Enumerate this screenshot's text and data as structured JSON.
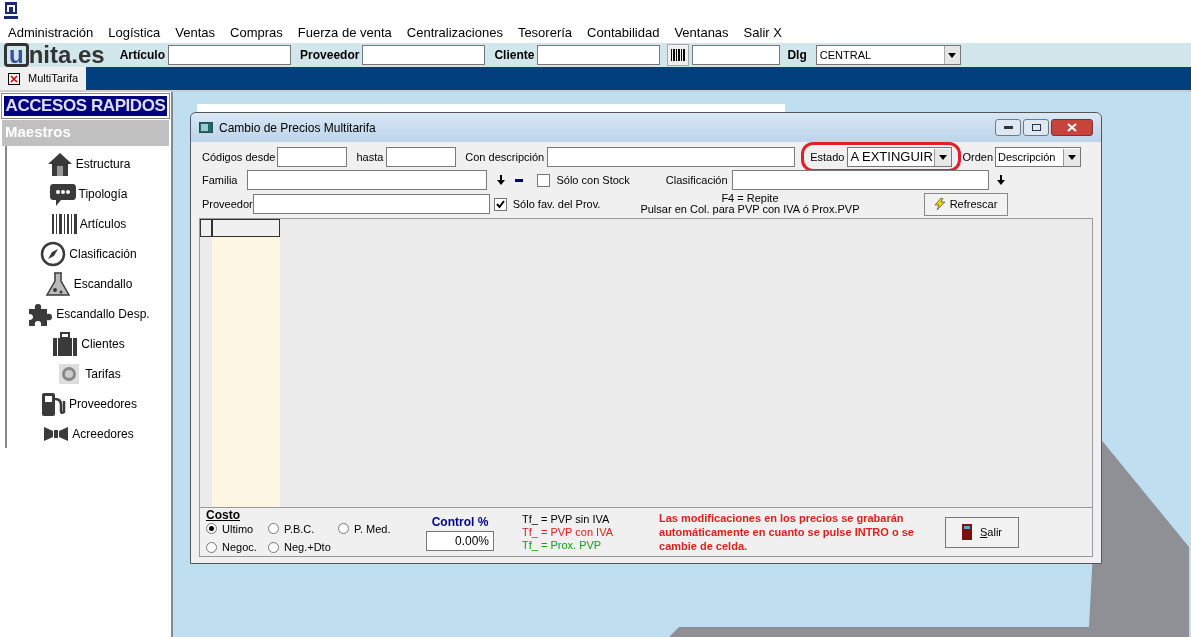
{
  "menu": [
    "Administración",
    "Logística",
    "Ventas",
    "Compras",
    "Fuerza de venta",
    "Centralizaciones",
    "Tesorería",
    "Contabilidad",
    "Ventanas",
    "Salir X"
  ],
  "toolbar": {
    "logo": {
      "boxed": "u",
      "rest": "nita.es"
    },
    "fields": [
      {
        "label": "Artículo"
      },
      {
        "label": "Proveedor"
      },
      {
        "label": "Cliente"
      }
    ],
    "dlg": {
      "label": "Dlg",
      "value": "CENTRAL"
    }
  },
  "tabs": [
    {
      "label": "MultiTarifa",
      "selected": true
    }
  ],
  "sidebar": {
    "title": "ACCESOS RAPIDOS",
    "section": "Maestros",
    "items": [
      {
        "label": "Estructura",
        "kind": "house"
      },
      {
        "label": "Tipología",
        "kind": "chat"
      },
      {
        "label": "Artículos",
        "kind": "barcode"
      },
      {
        "label": "Clasificación",
        "kind": "compass"
      },
      {
        "label": "Escandallo",
        "kind": "flask"
      },
      {
        "label": "Escandallo Desp.",
        "kind": "puzzle"
      },
      {
        "label": "Clientes",
        "kind": "case"
      },
      {
        "label": "Tarifas",
        "kind": "coin"
      },
      {
        "label": "Proveedores",
        "kind": "pump"
      },
      {
        "label": "Acreedores",
        "kind": "bow"
      }
    ]
  },
  "dialog": {
    "title": "Cambio de Precios Multitarifa",
    "codes_from": {
      "label": "Códigos desde"
    },
    "codes_to": {
      "label": "hasta"
    },
    "description": {
      "label": "Con descripción"
    },
    "estado": {
      "label": "Estado",
      "value": "A EXTINGUIR",
      "highlighted": true
    },
    "orden": {
      "label": "Orden",
      "value": "Descripción"
    },
    "familia": {
      "label": "Familia"
    },
    "stock_only": {
      "label": "Sólo con Stock",
      "checked": false
    },
    "clasificacion": {
      "label": "Clasificación"
    },
    "proveedor": {
      "label": "Proveedor"
    },
    "fav_only": {
      "label": "Sólo fav. del Prov.",
      "checked": true
    },
    "hints": [
      "F4 = Repite",
      "Pulsar en Col. para PVP con IVA ó Prox.PVP"
    ],
    "refresh_button": "Refrescar",
    "costo": {
      "title": "Costo",
      "options": [
        {
          "label": "Ultimo",
          "selected": true
        },
        {
          "label": "P.B.C.",
          "selected": false
        },
        {
          "label": "P. Med.",
          "selected": false
        },
        {
          "label": "Negoc.",
          "selected": false
        },
        {
          "label": "Neg.+Dto",
          "selected": false
        }
      ]
    },
    "control": {
      "label": "Control %",
      "value": "0.00%"
    },
    "legend": [
      {
        "text": "Tf_ = PVP sin IVA",
        "color": "#000000"
      },
      {
        "text": "Tf_ = PVP con IVA",
        "color": "#e02020"
      },
      {
        "text": "Tf_ = Prox. PVP",
        "color": "#10a010"
      }
    ],
    "notice": "Las modificaciones en los precios se grabarán automáticamente en cuanto se pulse INTRO o se cambie de celda.",
    "exit_button": "Salir"
  }
}
